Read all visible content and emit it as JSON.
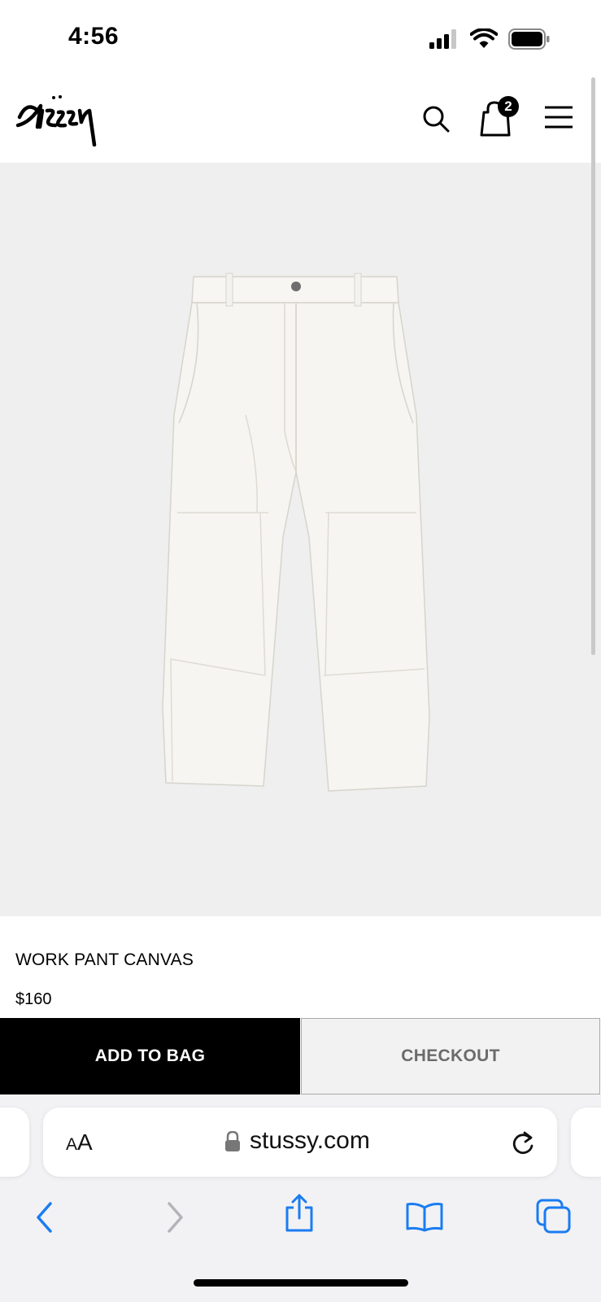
{
  "status_bar": {
    "time": "4:56",
    "icons": [
      "signal-icon",
      "wifi-icon",
      "battery-icon"
    ]
  },
  "header": {
    "logo_alt": "Stussy",
    "cart_count": "2",
    "icons": [
      "search-icon",
      "shopping-bag-icon",
      "menu-icon"
    ]
  },
  "product": {
    "name": "WORK PANT CANVAS",
    "price": "$160",
    "image": "work-pant-canvas-image"
  },
  "actions": {
    "add_to_bag": "ADD TO BAG",
    "checkout": "CHECKOUT"
  },
  "safari": {
    "aa_small": "A",
    "aa_large": "A",
    "url": "stussy.com",
    "toolbar_icons": [
      "back-icon",
      "forward-icon",
      "share-icon",
      "bookmarks-icon",
      "tabs-icon"
    ]
  },
  "colors": {
    "hero_background": "#efefef",
    "primary_button": "#000000",
    "safari_accent": "#1a7cf2"
  }
}
